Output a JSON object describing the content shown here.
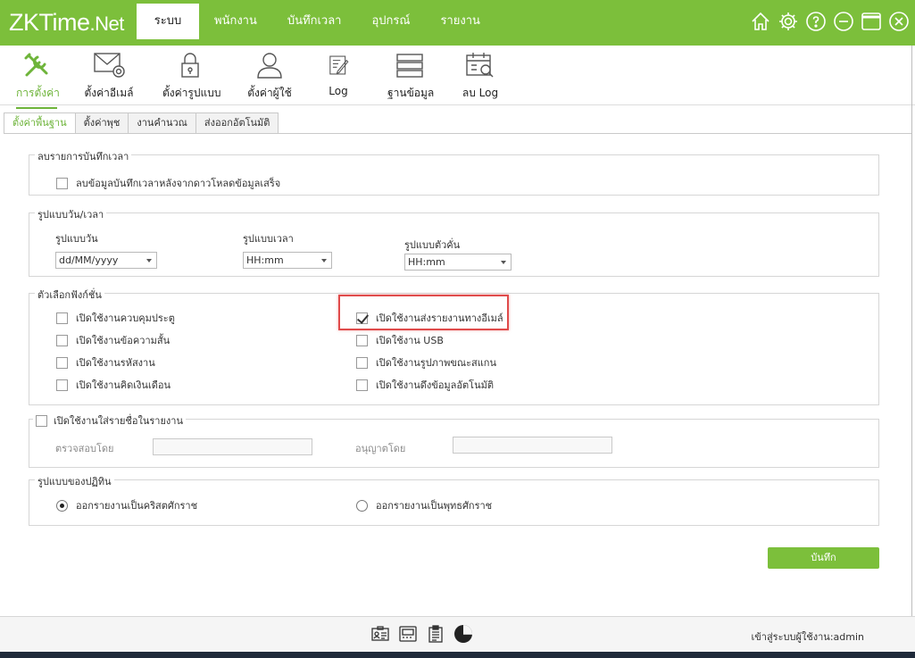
{
  "app": {
    "logo_main": "ZKTime",
    "logo_suffix": ".Net"
  },
  "menu": {
    "items": [
      {
        "label": "ระบบ",
        "active": true
      },
      {
        "label": "พนักงาน"
      },
      {
        "label": "บันทึกเวลา"
      },
      {
        "label": "อุปกรณ์"
      },
      {
        "label": "รายงาน"
      }
    ]
  },
  "window_icons": [
    "home-icon",
    "gear-icon",
    "help-icon",
    "minimize-icon",
    "maximize-icon",
    "close-icon"
  ],
  "toolbar": {
    "items": [
      {
        "label": "การตั้งค่า",
        "icon": "tools-icon",
        "active": true
      },
      {
        "label": "ตั้งค่าอีเมล์",
        "icon": "mail-settings-icon"
      },
      {
        "label": "ตั้งค่ารูปแบบ",
        "icon": "lock-icon"
      },
      {
        "label": "ตั้งค่าผู้ใช้",
        "icon": "user-icon"
      },
      {
        "label": "Log",
        "icon": "log-icon"
      },
      {
        "label": "ฐานข้อมูล",
        "icon": "database-icon"
      },
      {
        "label": "ลบ Log",
        "icon": "delete-log-icon"
      }
    ]
  },
  "subtabs": [
    {
      "label": "ตั้งค่าพื้นฐาน",
      "active": true
    },
    {
      "label": "ตั้งค่าพุช"
    },
    {
      "label": "งานคำนวณ"
    },
    {
      "label": "ส่งออกอัตโนมัติ"
    }
  ],
  "groups": {
    "delete_records": {
      "title": "ลบรายการบันทึกเวลา",
      "option": {
        "label": "ลบข้อมูลบันทึกเวลาหลังจากดาวโหลดข้อมูลเสร็จ",
        "checked": false
      }
    },
    "datetime_format": {
      "title": "รูปแบบวัน/เวลา",
      "date_label": "รูปแบบวัน",
      "date_value": "dd/MM/yyyy",
      "time_label": "รูปแบบเวลา",
      "time_value": "HH:mm",
      "separator_label": "รูปแบบตัวคั่น",
      "separator_value": "HH:mm"
    },
    "features": {
      "title": "ตัวเลือกฟังก์ชั่น",
      "left": [
        {
          "label": "เปิดใช้งานควบคุมประตู",
          "checked": false
        },
        {
          "label": "เปิดใช้งานข้อความสั้น",
          "checked": false
        },
        {
          "label": "เปิดใช้งานรหัสงาน",
          "checked": false
        },
        {
          "label": "เปิดใช้งานคิดเงินเดือน",
          "checked": false
        }
      ],
      "right": [
        {
          "label": "เปิดใช้งานส่งรายงานทางอีเมล์",
          "checked": true
        },
        {
          "label": "เปิดใช้งาน USB",
          "checked": false
        },
        {
          "label": "เปิดใช้งานรูปภาพขณะสแกน",
          "checked": false
        },
        {
          "label": "เปิดใช้งานดึงข้อมูลอัตโนมัติ",
          "checked": false
        }
      ]
    },
    "report_names": {
      "title": "เปิดใช้งานใส่รายชื่อในรายงาน",
      "checked": false,
      "checked_by_label": "ตรวจสอบโดย",
      "checked_by_value": "",
      "approved_by_label": "อนุญาตโดย",
      "approved_by_value": ""
    },
    "calendar": {
      "title": "รูปแบบของปฏิทิน",
      "options": [
        {
          "label": "ออกรายงานเป็นคริสตศักราช",
          "selected": true
        },
        {
          "label": "ออกรายงานเป็นพุทธศักราช",
          "selected": false
        }
      ]
    }
  },
  "save_label": "บันทึก",
  "status": {
    "icons": [
      "id-card-icon",
      "device-icon",
      "clipboard-icon",
      "pie-chart-icon"
    ],
    "login_text": "เข้าสู่ระบบผู้ใช้งาน:admin"
  },
  "colors": {
    "brand_green": "#7cbf3b",
    "active_green": "#6eb43a",
    "highlight_red": "#e04b4b"
  }
}
